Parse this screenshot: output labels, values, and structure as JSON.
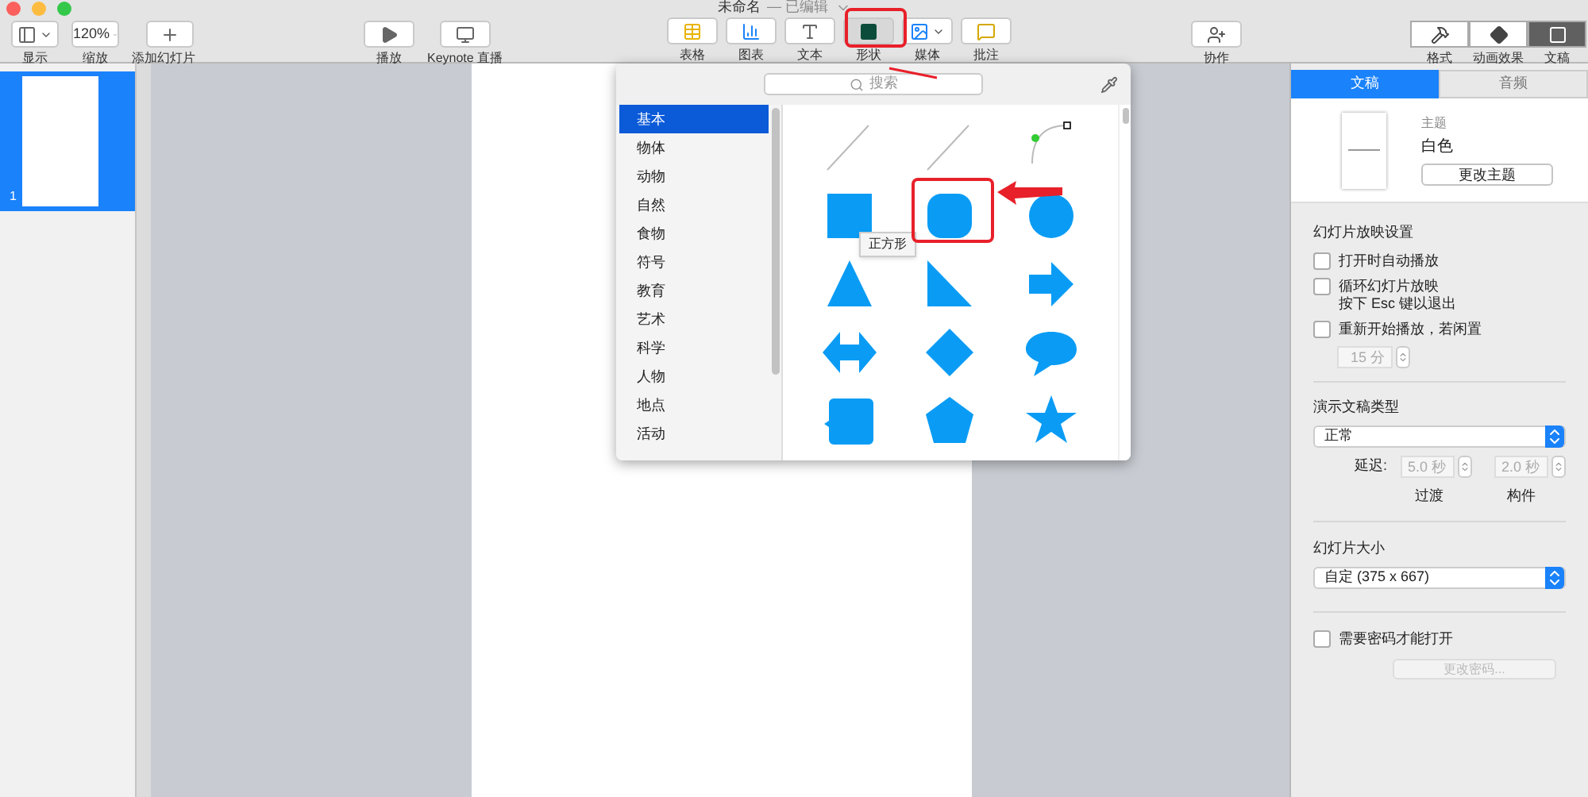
{
  "window": {
    "title": "未命名",
    "status": "— 已编辑"
  },
  "toolbar_left": [
    {
      "kind": "view",
      "label": "显示"
    },
    {
      "kind": "zoom",
      "label": "缩放",
      "value": "120%"
    },
    {
      "kind": "add",
      "label": "添加幻灯片"
    }
  ],
  "toolbar_play": [
    {
      "kind": "play",
      "label": "播放"
    },
    {
      "kind": "live",
      "label": "Keynote 直播"
    }
  ],
  "toolbar_insert": [
    {
      "kind": "table",
      "label": "表格",
      "selected": false
    },
    {
      "kind": "chart",
      "label": "图表",
      "selected": false
    },
    {
      "kind": "text",
      "label": "文本",
      "selected": false
    },
    {
      "kind": "shape",
      "label": "形状",
      "selected": true
    },
    {
      "kind": "media",
      "label": "媒体",
      "selected": false
    },
    {
      "kind": "comment",
      "label": "批注",
      "selected": false
    }
  ],
  "collaborate": {
    "label": "协作"
  },
  "inspector_tabs": [
    {
      "kind": "format",
      "label": "格式",
      "selected": false
    },
    {
      "kind": "animate",
      "label": "动画效果",
      "selected": false
    },
    {
      "kind": "document",
      "label": "文稿",
      "selected": true
    }
  ],
  "slides": [
    {
      "number": "1",
      "selected": true
    }
  ],
  "shape_popover": {
    "search_placeholder": "搜索",
    "categories": [
      {
        "label": "基本",
        "selected": true
      },
      {
        "label": "物体",
        "selected": false
      },
      {
        "label": "动物",
        "selected": false
      },
      {
        "label": "自然",
        "selected": false
      },
      {
        "label": "食物",
        "selected": false
      },
      {
        "label": "符号",
        "selected": false
      },
      {
        "label": "教育",
        "selected": false
      },
      {
        "label": "艺术",
        "selected": false
      },
      {
        "label": "科学",
        "selected": false
      },
      {
        "label": "人物",
        "selected": false
      },
      {
        "label": "地点",
        "selected": false
      },
      {
        "label": "活动",
        "selected": false
      }
    ],
    "shapes": [
      {
        "kind": "line"
      },
      {
        "kind": "line"
      },
      {
        "kind": "curve"
      },
      {
        "kind": "square"
      },
      {
        "kind": "rounded-square"
      },
      {
        "kind": "circle"
      },
      {
        "kind": "triangle"
      },
      {
        "kind": "right-triangle"
      },
      {
        "kind": "arrow"
      },
      {
        "kind": "double-arrow"
      },
      {
        "kind": "diamond"
      },
      {
        "kind": "speech-bubble"
      },
      {
        "kind": "callout"
      },
      {
        "kind": "pentagon"
      },
      {
        "kind": "star"
      }
    ],
    "tooltip": "正方形"
  },
  "document_panel": {
    "tabs": [
      {
        "label": "文稿",
        "selected": true
      },
      {
        "label": "音频",
        "selected": false
      }
    ],
    "theme_label": "主题",
    "theme_name": "白色",
    "change_theme": "更改主题",
    "slideshow_title": "幻灯片放映设置",
    "options": [
      {
        "label": "打开时自动播放",
        "checked": false
      },
      {
        "label": "循环幻灯片放映",
        "note": "按下 Esc 键以退出",
        "checked": false
      },
      {
        "label": "重新开始播放，若闲置",
        "checked": false
      }
    ],
    "idle_value": "15 分",
    "type_title": "演示文稿类型",
    "type_value": "正常",
    "delay_label": "延迟:",
    "transition_value": "5.0 秒",
    "transition_label": "过渡",
    "build_value": "2.0 秒",
    "build_label": "构件",
    "size_title": "幻灯片大小",
    "size_value": "自定 (375 x 667)",
    "password": {
      "label": "需要密码才能打开",
      "checked": false
    },
    "change_password": "更改密码..."
  }
}
